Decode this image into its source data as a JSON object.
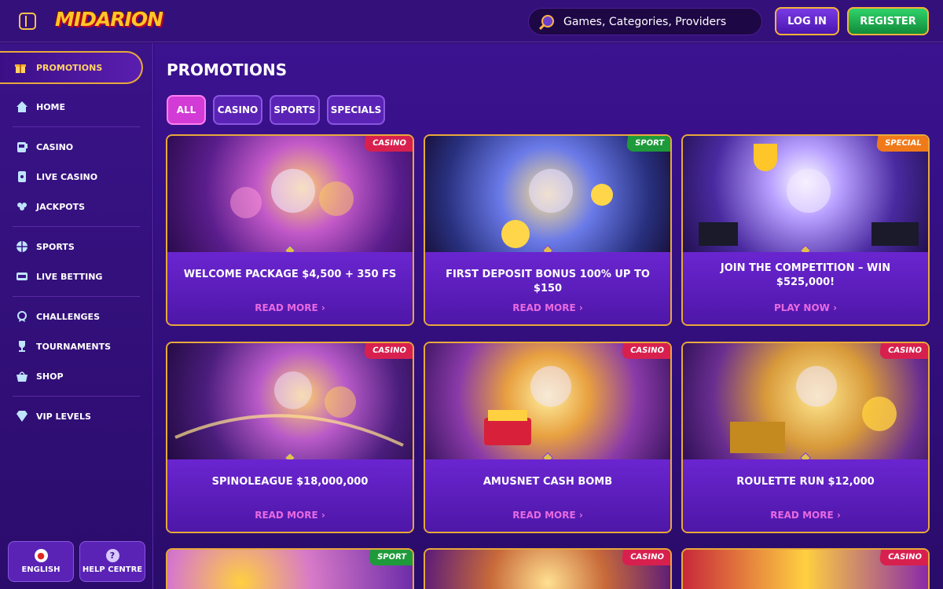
{
  "header": {
    "logo": "MIDARION",
    "search_placeholder": "Games, Categories, Providers",
    "login_label": "LOG IN",
    "register_label": "REGISTER"
  },
  "sidebar": {
    "active": "PROMOTIONS",
    "items": [
      {
        "label": "HOME",
        "icon": "home-icon"
      },
      {
        "label": "CASINO",
        "icon": "slot-icon"
      },
      {
        "label": "LIVE CASINO",
        "icon": "card-icon"
      },
      {
        "label": "JACKPOTS",
        "icon": "clover-icon"
      },
      {
        "label": "SPORTS",
        "icon": "ball-icon"
      },
      {
        "label": "LIVE BETTING",
        "icon": "live-icon"
      },
      {
        "label": "CHALLENGES",
        "icon": "medal-icon"
      },
      {
        "label": "TOURNAMENTS",
        "icon": "trophy-icon"
      },
      {
        "label": "SHOP",
        "icon": "basket-icon"
      },
      {
        "label": "VIP LEVELS",
        "icon": "diamond-icon"
      }
    ],
    "bottom": [
      {
        "label": "ENGLISH",
        "icon": "canada-flag-icon"
      },
      {
        "label": "HELP CENTRE",
        "icon": "help-icon"
      }
    ]
  },
  "main": {
    "title": "PROMOTIONS",
    "filters": [
      "ALL",
      "CASINO",
      "SPORTS",
      "SPECIALS"
    ],
    "active_filter": "ALL",
    "cards": [
      {
        "badge": "CASINO",
        "title": "WELCOME PACKAGE $4,500 + 350 FS",
        "link": "READ MORE"
      },
      {
        "badge": "SPORT",
        "title": "FIRST DEPOSIT BONUS 100% UP TO $150",
        "link": "READ MORE"
      },
      {
        "badge": "SPECIAL",
        "title": "JOIN THE COMPETITION – WIN $525,000!",
        "link": "PLAY NOW"
      },
      {
        "badge": "CASINO",
        "title": "SPINOLEAGUE $18,000,000",
        "link": "READ MORE"
      },
      {
        "badge": "CASINO",
        "title": "AMUSNET CASH BOMB",
        "link": "READ MORE"
      },
      {
        "badge": "CASINO",
        "title": "ROULETTE RUN $12,000",
        "link": "READ MORE"
      },
      {
        "badge": "SPORT",
        "title": "",
        "link": ""
      },
      {
        "badge": "CASINO",
        "title": "",
        "link": ""
      },
      {
        "badge": "CASINO",
        "title": "",
        "link": ""
      }
    ]
  },
  "colors": {
    "accent_gold": "#f6b43a",
    "link_pink": "#e86ae0",
    "badge_casino": "#d8204f",
    "badge_sport": "#1e9a3a",
    "badge_special": "#f07a1a"
  }
}
